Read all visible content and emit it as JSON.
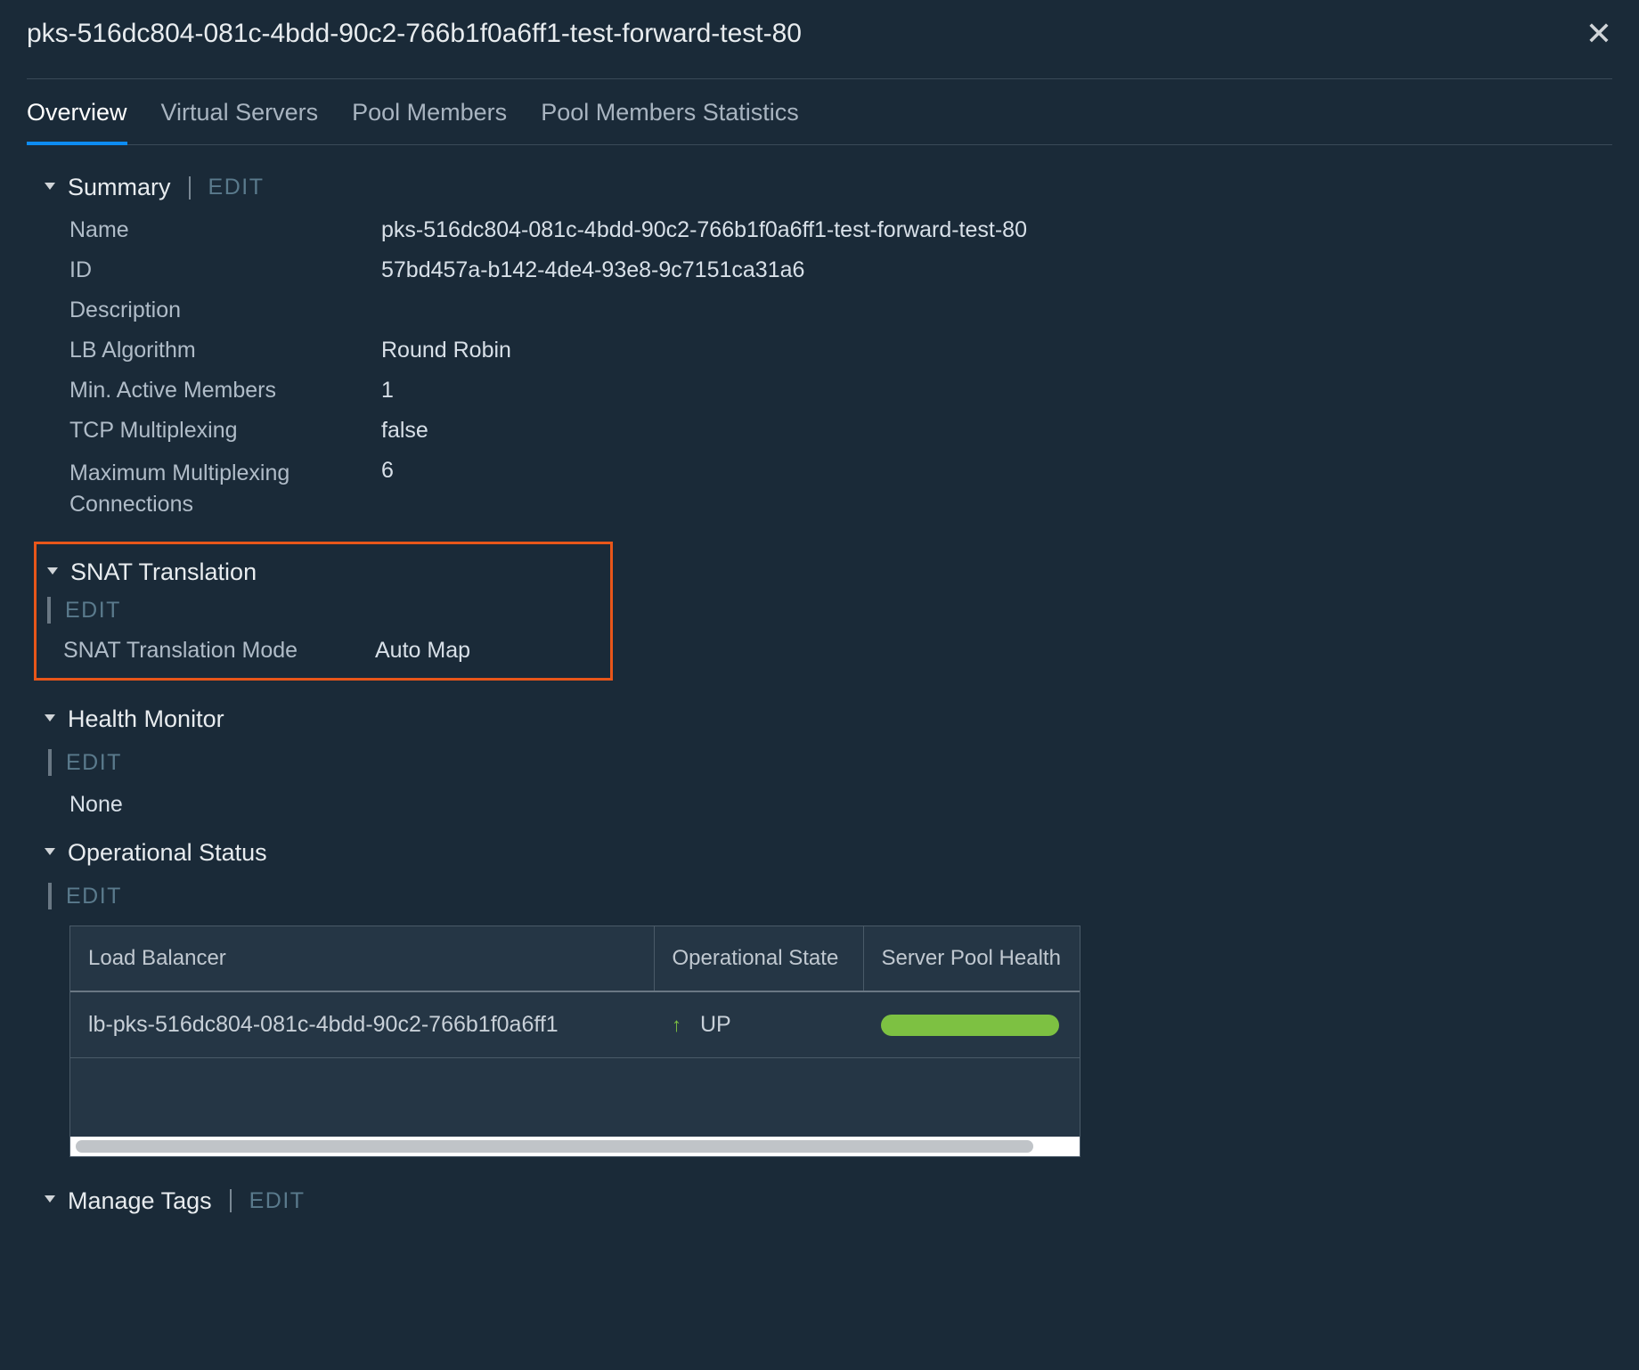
{
  "header": {
    "title": "pks-516dc804-081c-4bdd-90c2-766b1f0a6ff1-test-forward-test-80"
  },
  "tabs": {
    "overview": "Overview",
    "virtual_servers": "Virtual Servers",
    "pool_members": "Pool Members",
    "pool_stats": "Pool Members Statistics"
  },
  "summary": {
    "title": "Summary",
    "edit": "EDIT",
    "labels": {
      "name": "Name",
      "id": "ID",
      "description": "Description",
      "lb_algo": "LB Algorithm",
      "min_active": "Min. Active Members",
      "tcp_mux": "TCP Multiplexing",
      "max_mux": "Maximum Multiplexing Connections"
    },
    "values": {
      "name": "pks-516dc804-081c-4bdd-90c2-766b1f0a6ff1-test-forward-test-80",
      "id": "57bd457a-b142-4de4-93e8-9c7151ca31a6",
      "description": "",
      "lb_algo": "Round Robin",
      "min_active": "1",
      "tcp_mux": "false",
      "max_mux": "6"
    }
  },
  "snat": {
    "title": "SNAT Translation",
    "edit": "EDIT",
    "mode_label": "SNAT Translation Mode",
    "mode_value": "Auto Map"
  },
  "health": {
    "title": "Health Monitor",
    "edit": "EDIT",
    "value": "None"
  },
  "op_status": {
    "title": "Operational Status",
    "edit": "EDIT",
    "columns": {
      "lb": "Load Balancer",
      "state": "Operational State",
      "health": "Server Pool Health"
    },
    "row": {
      "lb": "lb-pks-516dc804-081c-4bdd-90c2-766b1f0a6ff1",
      "state": "UP"
    }
  },
  "tags": {
    "title": "Manage Tags",
    "edit": "EDIT"
  }
}
